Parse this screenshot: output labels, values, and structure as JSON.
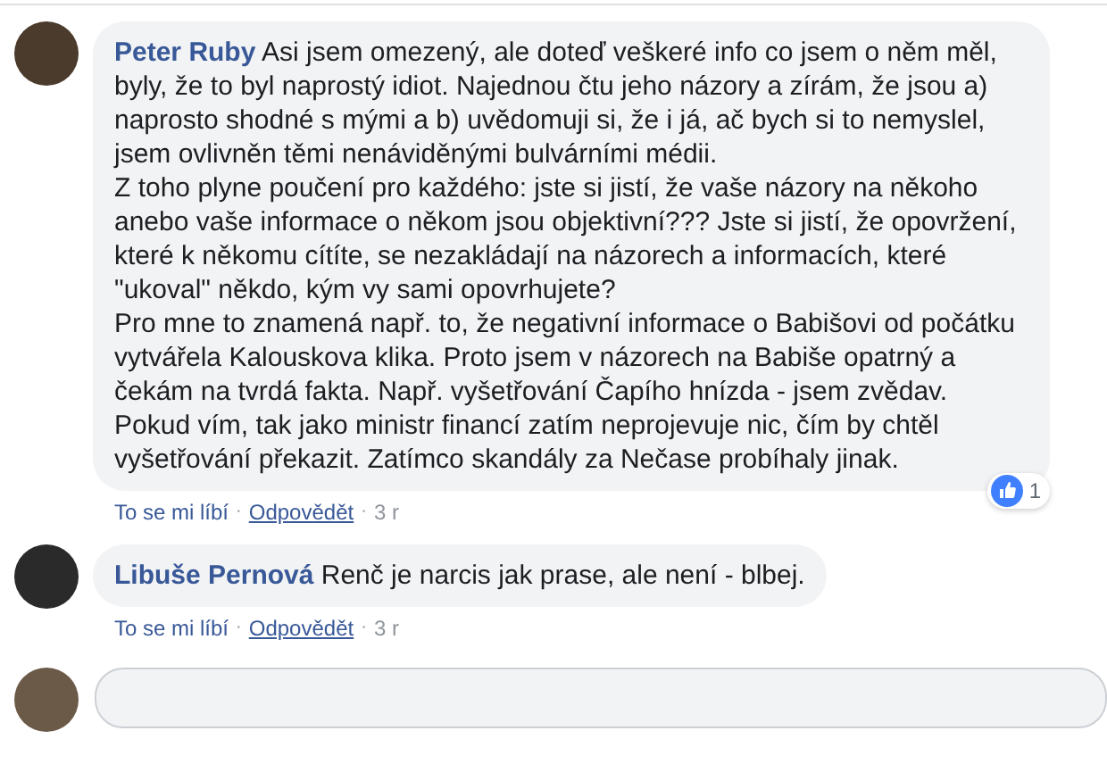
{
  "separator": "·",
  "comments": [
    {
      "author": "Peter Ruby",
      "text": "Asi jsem omezený, ale doteď veškeré info co jsem o něm měl, byly, že to byl naprostý idiot. Najednou čtu jeho názory a zírám, že jsou a) naprosto shodné s mými a b) uvědomuji si, že i já, ač bych si to nemyslel, jsem ovlivněn těmi nenáviděnými bulvárními médii.\nZ toho plyne poučení pro každého: jste si jistí, že vaše názory na někoho anebo vaše informace o někom jsou objektivní??? Jste si jistí, že opovržení, které k někomu cítíte, se nezakládají na názorech a informacích, které \"ukoval\" někdo, kým vy sami opovrhujete?\nPro mne to znamená např. to, že negativní informace o Babišovi od počátku vytvářela Kalouskova klika. Proto jsem v názorech na Babiše opatrný a čekám na tvrdá fakta. Např. vyšetřování Čapího hnízda - jsem zvědav. Pokud vím, tak jako ministr financí zatím neprojevuje nic, čím by chtěl vyšetřování překazit. Zatímco skandály za Nečase probíhaly jinak.",
      "reactions": "1",
      "actions": [
        "To se mi líbí",
        "Odpovědět"
      ],
      "time": "3 r"
    },
    {
      "author": "Libuše Pernová",
      "text": "Renč je narcis jak prase, ale není - blbej.",
      "actions": [
        "To se mi líbí",
        "Odpovědět"
      ],
      "time": "3 r"
    }
  ]
}
